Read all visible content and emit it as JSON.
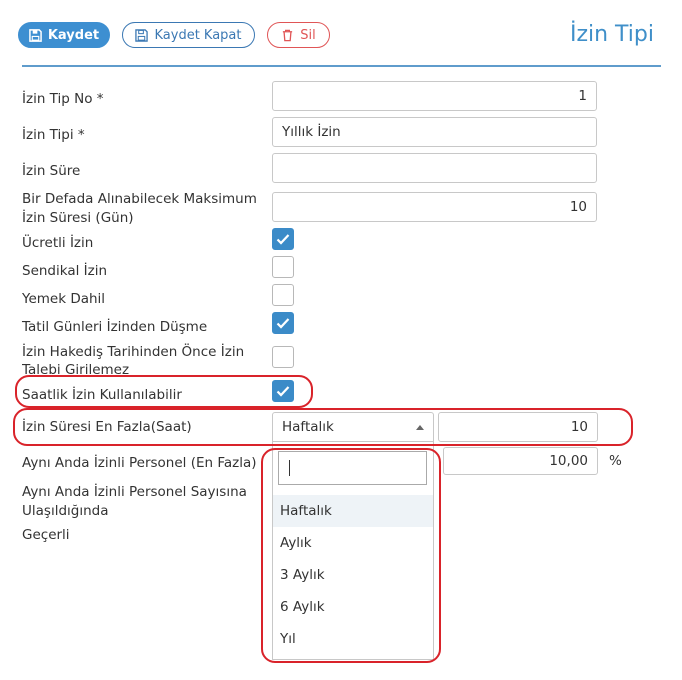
{
  "toolbar": {
    "save_label": "Kaydet",
    "save_close_label": "Kaydet Kapat",
    "delete_label": "Sil"
  },
  "page": {
    "title": "İzin Tipi"
  },
  "form": {
    "izin_tip_no": {
      "label": "İzin Tip No *",
      "value": "1"
    },
    "izin_tipi": {
      "label": "İzin Tipi *",
      "value": "Yıllık İzin"
    },
    "izin_sure": {
      "label": "İzin Süre",
      "value": ""
    },
    "maksimum": {
      "label_line1": "Bir Defada Alınabilecek Maksimum",
      "label_line2": "İzin Süresi (Gün)",
      "value": "10"
    },
    "ucretli": {
      "label": "Ücretli İzin",
      "checked": true
    },
    "sendikal": {
      "label": "Sendikal İzin",
      "checked": false
    },
    "yemek": {
      "label": "Yemek Dahil",
      "checked": false
    },
    "tatil": {
      "label": "Tatil Günleri İzinden Düşme",
      "checked": true
    },
    "hakedis": {
      "label_line1": "İzin Hakediş Tarihinden Önce İzin",
      "label_line2": "Talebi Girilemez",
      "checked": false
    },
    "saatlik": {
      "label": "Saatlik İzin Kullanılabilir",
      "checked": true
    },
    "en_fazla": {
      "label": "İzin Süresi En Fazla(Saat)",
      "period": "Haftalık",
      "value": "10"
    },
    "ayni_anda": {
      "label": "Aynı Anda İzinli Personel (En Fazla)",
      "value": "10,00",
      "unit": "%"
    },
    "sayisina": {
      "label_line1": "Aynı Anda İzinli Personel Sayısına",
      "label_line2": "Ulaşıldığında"
    },
    "gecerli": {
      "label": "Geçerli"
    }
  },
  "dropdown": {
    "search_value": "",
    "options": [
      "Haftalık",
      "Aylık",
      "3 Aylık",
      "6 Aylık",
      "Yıl"
    ],
    "highlighted": "Haftalık"
  },
  "colors": {
    "primary": "#3d8fd1",
    "danger": "#e05556",
    "title": "#3f8fc9",
    "annotation": "#d9232a"
  },
  "icons": {
    "save": "floppy-disk-icon",
    "delete": "trash-icon",
    "check": "checkmark-icon",
    "caret": "caret-up-icon"
  }
}
